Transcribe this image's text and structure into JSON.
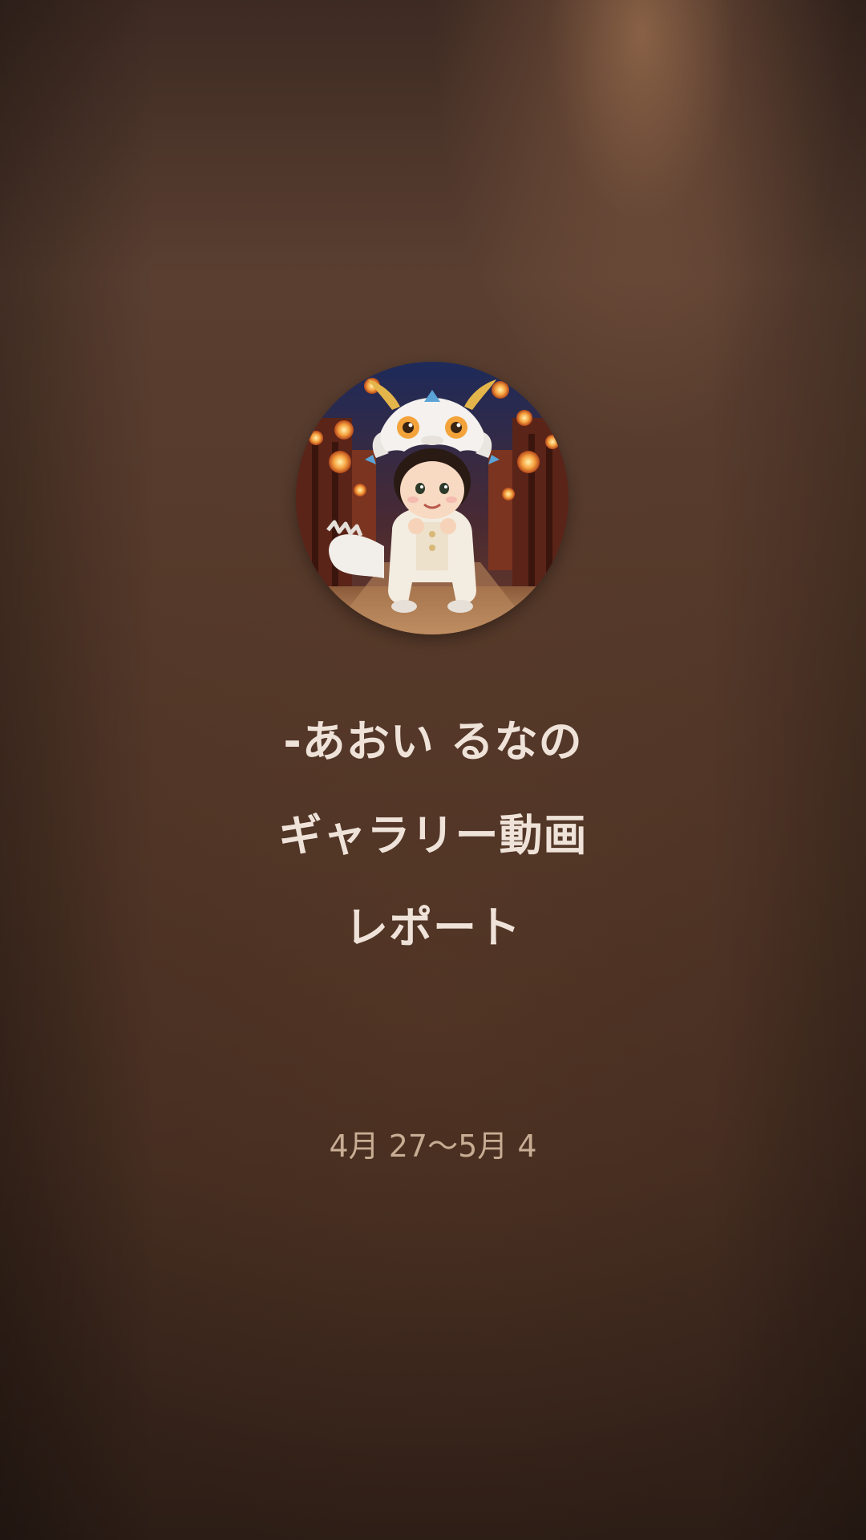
{
  "story": {
    "avatar_icon": "child-in-white-dragon-costume-avatar",
    "title_lines": [
      "-あおい るなの",
      "ギャラリー動画",
      "レポート"
    ],
    "date_range": "4月 27〜5月 4",
    "colors": {
      "background": "#4e3426",
      "title": "#efe3d9",
      "date": "#c8ad94"
    }
  }
}
